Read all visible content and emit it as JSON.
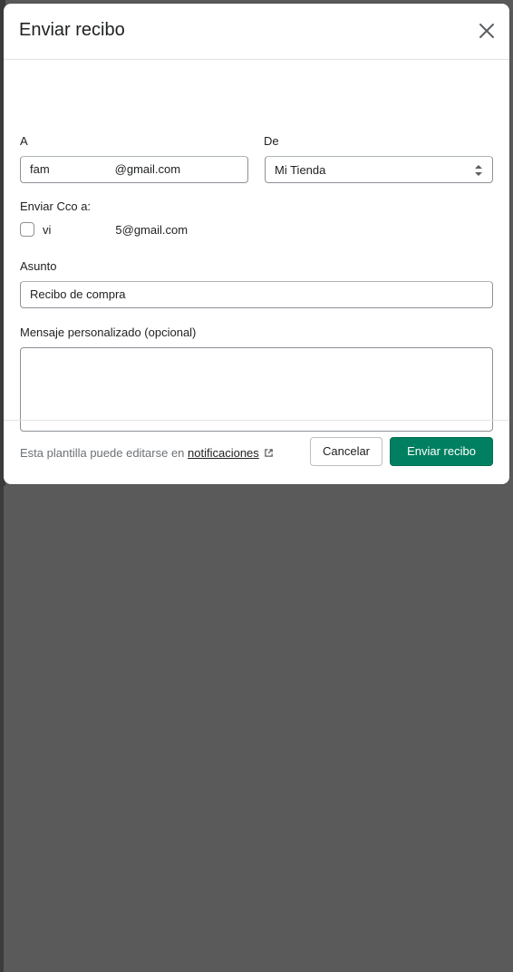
{
  "modal": {
    "title": "Enviar recibo",
    "to_label": "A",
    "to_value_prefix": "fam",
    "to_value_suffix": "@gmail.com",
    "from_label": "De",
    "from_value": "Mi Tienda",
    "bcc_label": "Enviar Cco a:",
    "bcc_email_prefix": "vi",
    "bcc_email_suffix": "5@gmail.com",
    "bcc_checked": false,
    "subject_label": "Asunto",
    "subject_value": "Recibo de compra",
    "message_label": "Mensaje personalizado (opcional)",
    "message_value": "",
    "hint_text": "Esta plantilla puede editarse en ",
    "hint_link": "notificaciones",
    "cancel_label": "Cancelar",
    "submit_label": "Enviar recibo"
  },
  "colors": {
    "primary": "#008060",
    "border": "#8c9196",
    "divider": "#e1e3e5"
  },
  "icons": [
    "close-icon",
    "select-arrows-icon",
    "external-link-icon"
  ]
}
